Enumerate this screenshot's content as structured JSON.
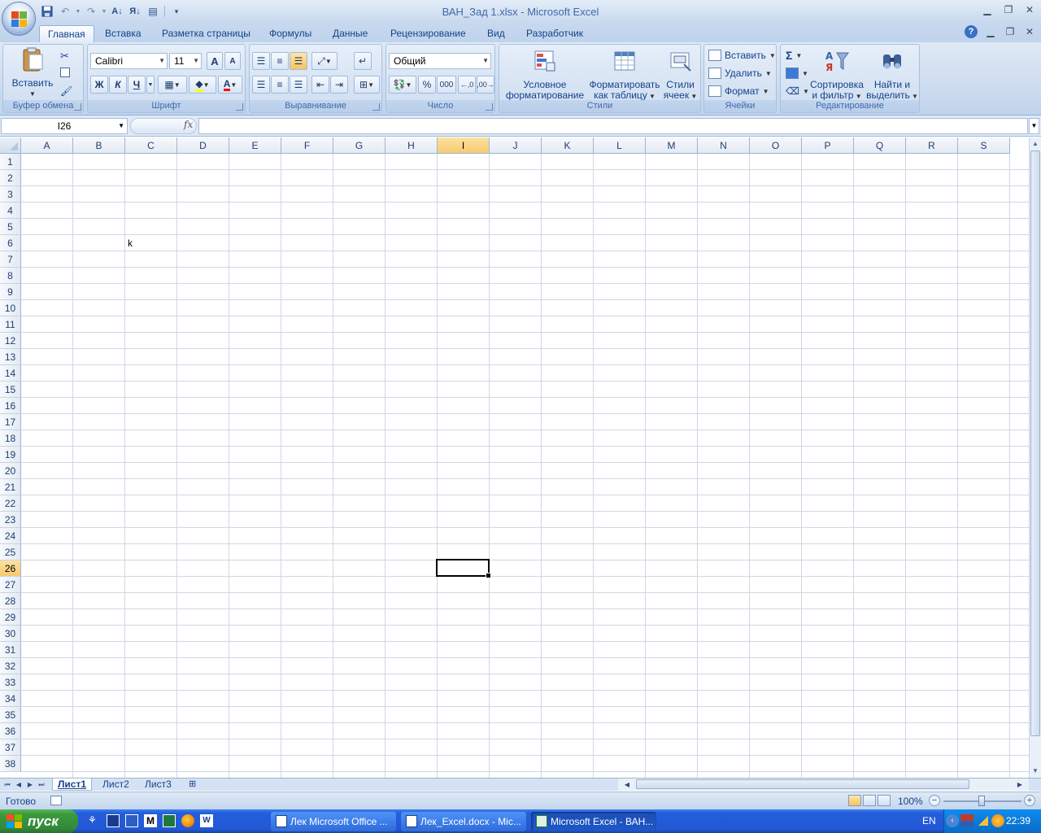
{
  "window": {
    "title": "ВАН_Зад 1.xlsx - Microsoft Excel",
    "controls": [
      "minimize",
      "restore",
      "close"
    ]
  },
  "ribbon": {
    "tabs": [
      "Главная",
      "Вставка",
      "Разметка страницы",
      "Формулы",
      "Данные",
      "Рецензирование",
      "Вид",
      "Разработчик"
    ],
    "active_tab": "Главная",
    "groups": {
      "clipboard": {
        "label": "Буфер обмена",
        "paste": "Вставить"
      },
      "font": {
        "label": "Шрифт",
        "font_name": "Calibri",
        "font_size": "11",
        "bold": "Ж",
        "italic": "К",
        "underline": "Ч",
        "grow": "A",
        "shrink": "A",
        "font_color": "A"
      },
      "alignment": {
        "label": "Выравнивание"
      },
      "number": {
        "label": "Число",
        "format": "Общий",
        "percent": "%",
        "thousands": "000"
      },
      "styles": {
        "label": "Стили",
        "conditional": [
          "Условное",
          "форматирование"
        ],
        "as_table": [
          "Форматировать",
          "как таблицу"
        ],
        "cell_styles": [
          "Стили",
          "ячеек"
        ]
      },
      "cells": {
        "label": "Ячейки",
        "insert": "Вставить",
        "delete": "Удалить",
        "format": "Формат"
      },
      "editing": {
        "label": "Редактирование",
        "sum": "Σ",
        "sort": [
          "Сортировка",
          "и фильтр"
        ],
        "find": [
          "Найти и",
          "выделить"
        ]
      }
    }
  },
  "formula_bar": {
    "name_box": "I26",
    "fx": "fx",
    "formula": ""
  },
  "grid": {
    "columns": [
      "A",
      "B",
      "C",
      "D",
      "E",
      "F",
      "G",
      "H",
      "I",
      "J",
      "K",
      "L",
      "M",
      "N",
      "O",
      "P",
      "Q",
      "R",
      "S"
    ],
    "rows": [
      "1",
      "2",
      "3",
      "4",
      "5",
      "6",
      "7",
      "8",
      "9",
      "10",
      "11",
      "12",
      "13",
      "14",
      "15",
      "16",
      "17",
      "18",
      "19",
      "20",
      "21",
      "22",
      "23",
      "24",
      "25",
      "26",
      "27",
      "28",
      "29",
      "30",
      "31",
      "32",
      "33",
      "34",
      "35",
      "36",
      "37",
      "38"
    ],
    "selected_column": "I",
    "selected_row": "26",
    "cells": [
      {
        "ref": "C6",
        "col": "C",
        "row": "6",
        "value": "k"
      }
    ]
  },
  "sheets": {
    "tabs": [
      "Лист1",
      "Лист2",
      "Лист3"
    ],
    "active": "Лист1"
  },
  "status": {
    "text": "Готово",
    "zoom": "100%",
    "zoom_level_percent": 100
  },
  "taskbar": {
    "start_label": "пуск",
    "windows": [
      {
        "label": "Лек Microsoft Office ...",
        "active": false
      },
      {
        "label": "Лек_Excel.docx - Mic...",
        "active": false
      },
      {
        "label": "Microsoft Excel - ВАН...",
        "active": true
      }
    ],
    "lang": "EN",
    "clock": "22:39"
  },
  "colors": {
    "ribbon_text": "#15428b",
    "selection_header": "#f8c970",
    "gridline": "#d0d7e5",
    "taskbar": "#245edb",
    "start_button": "#3c9a3c"
  }
}
